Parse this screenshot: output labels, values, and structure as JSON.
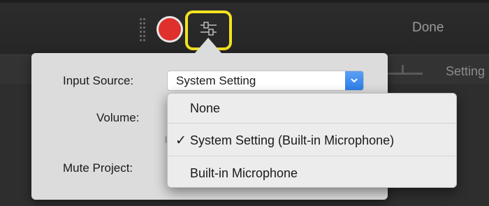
{
  "toolbar": {
    "done_label": "Done",
    "record_icon": "record-icon",
    "options_icon": "sliders-icon",
    "highlight_color": "#f4e31f",
    "record_color": "#e0302c"
  },
  "background": {
    "settings_label": "Setting"
  },
  "popover": {
    "input_source_label": "Input Source:",
    "volume_label": "Volume:",
    "mute_project_label": "Mute Project:",
    "select": {
      "value": "System Setting",
      "accent_color": "#2f7fe8"
    },
    "menu": {
      "items": [
        {
          "label": "None",
          "checked": false
        },
        {
          "label": "System Setting (Built-in Microphone)",
          "checked": true,
          "check_glyph": "✓"
        },
        {
          "label": "Built-in Microphone",
          "checked": false
        }
      ]
    }
  }
}
